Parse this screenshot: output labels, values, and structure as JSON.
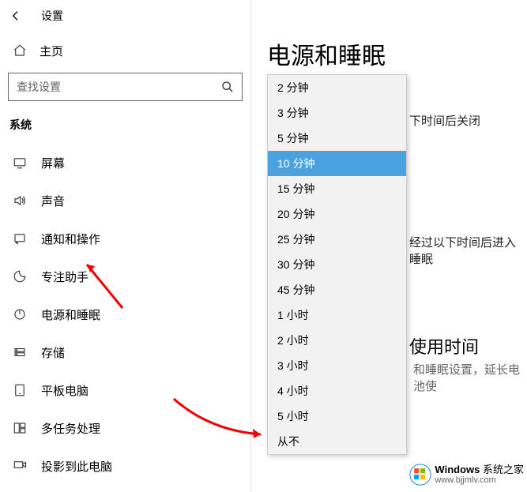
{
  "app": {
    "name": "设置"
  },
  "home": {
    "label": "主页"
  },
  "search": {
    "placeholder": "查找设置"
  },
  "section": {
    "header": "系统"
  },
  "nav": {
    "items": [
      {
        "label": "屏幕"
      },
      {
        "label": "声音"
      },
      {
        "label": "通知和操作"
      },
      {
        "label": "专注助手"
      },
      {
        "label": "电源和睡眠"
      },
      {
        "label": "存储"
      },
      {
        "label": "平板电脑"
      },
      {
        "label": "多任务处理"
      },
      {
        "label": "投影到此电脑"
      }
    ]
  },
  "page": {
    "title": "电源和睡眠",
    "desc1": "下时间后关闭",
    "desc2": "经过以下时间后进入睡眠",
    "section_title": "使用时间",
    "section_sub": "和睡眠设置，延长电池使"
  },
  "dropdown": {
    "selected_index": 3,
    "items": [
      "2 分钟",
      "3 分钟",
      "5 分钟",
      "10 分钟",
      "15 分钟",
      "20 分钟",
      "25 分钟",
      "30 分钟",
      "45 分钟",
      "1 小时",
      "2 小时",
      "3 小时",
      "4 小时",
      "5 小时",
      "从不"
    ]
  },
  "watermark": {
    "brand": "Windows",
    "suffix": "系统之家",
    "url": "www.bjjmlv.com"
  }
}
